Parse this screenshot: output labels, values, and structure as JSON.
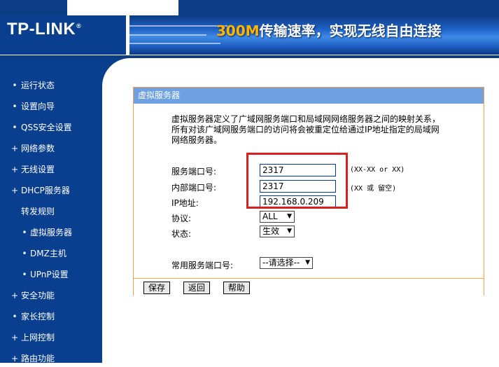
{
  "header": {
    "logo": "TP-LINK",
    "logo_mark": "®",
    "banner_accent": "300M",
    "banner_text": "传输速率，实现无线自由连接"
  },
  "sidebar": {
    "items": [
      {
        "label": "运行状态",
        "bullet": "•"
      },
      {
        "label": "设置向导",
        "bullet": "•"
      },
      {
        "label": "QSS安全设置",
        "bullet": "•"
      },
      {
        "label": "网络参数",
        "bullet": "+"
      },
      {
        "label": "无线设置",
        "bullet": "+"
      },
      {
        "label": "DHCP服务器",
        "bullet": "+"
      },
      {
        "label": "转发规则",
        "bullet": ""
      },
      {
        "label": "虚拟服务器",
        "bullet": "•"
      },
      {
        "label": "DMZ主机",
        "bullet": "•"
      },
      {
        "label": "UPnP设置",
        "bullet": "•"
      },
      {
        "label": "安全功能",
        "bullet": "+"
      },
      {
        "label": "家长控制",
        "bullet": "•"
      },
      {
        "label": "上网控制",
        "bullet": "+"
      },
      {
        "label": "路由功能",
        "bullet": "+"
      }
    ]
  },
  "panel": {
    "title": "虚拟服务器",
    "description": [
      "虚拟服务器定义了广域网服务端口和局域网网络服务器之间的映射关系，",
      "所有对该广域网服务端口的访问将会被重定位给通过IP地址指定的局域网",
      "网络服务器。"
    ],
    "form": {
      "service_port_label": "服务端口号:",
      "service_port_value": "2317",
      "service_port_hint": "(XX-XX or XX)",
      "internal_port_label": "内部端口号:",
      "internal_port_value": "2317",
      "internal_port_hint": "(XX 或 留空)",
      "ip_label": "IP地址:",
      "ip_value": "192.168.0.209",
      "protocol_label": "协议:",
      "protocol_value": "ALL",
      "status_label": "状态:",
      "status_value": "生效",
      "common_port_label": "常用服务端口号:",
      "common_port_value": "--请选择--"
    },
    "buttons": {
      "save": "保存",
      "back": "返回",
      "help": "帮助"
    }
  },
  "colors": {
    "brand_blue": "#0a3f8f",
    "panel_header": "#6fa0e2",
    "panel_border": "#f5a24b",
    "highlight_red": "#d9201f",
    "banner_accent": "#ffb400"
  }
}
